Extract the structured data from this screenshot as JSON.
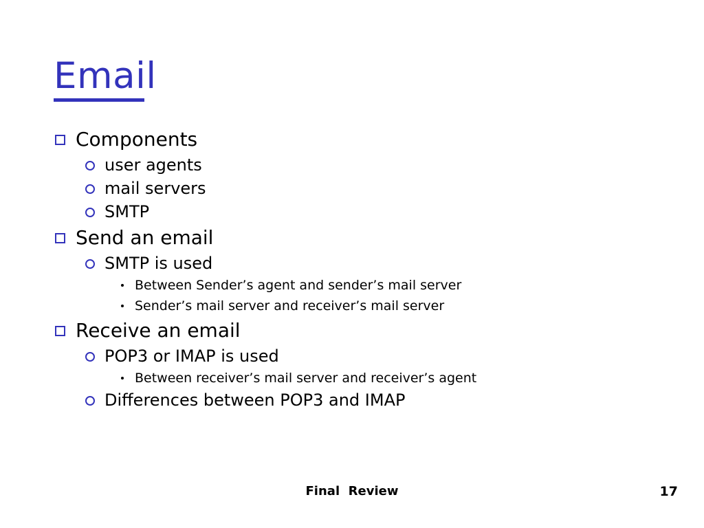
{
  "slide": {
    "title": "Email",
    "title_color": "#3333bb",
    "text_color": "#000000",
    "background_color": "#ffffff",
    "marker_color": "#3333bb",
    "outline": [
      {
        "level": 1,
        "text": "Components"
      },
      {
        "level": 2,
        "text": "user agents"
      },
      {
        "level": 2,
        "text": "mail servers"
      },
      {
        "level": 2,
        "text": "SMTP"
      },
      {
        "level": 1,
        "text": "Send an email"
      },
      {
        "level": 2,
        "text": "SMTP is used"
      },
      {
        "level": 3,
        "text": "Between Sender’s agent and sender’s mail server"
      },
      {
        "level": 3,
        "text": "Sender’s mail server and receiver’s mail server"
      },
      {
        "level": 1,
        "text": "Receive an email"
      },
      {
        "level": 2,
        "text": "POP3 or IMAP is used"
      },
      {
        "level": 3,
        "text": "Between receiver’s mail server and receiver’s agent"
      },
      {
        "level": 2,
        "text": "Differences between POP3 and IMAP"
      }
    ]
  },
  "footer": {
    "label": "Final  Review",
    "page_number": "17"
  }
}
